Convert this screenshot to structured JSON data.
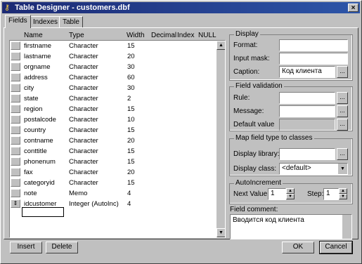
{
  "window": {
    "title": "Table Designer - customers.dbf",
    "close": "×"
  },
  "tabs": [
    "Fields",
    "Indexes",
    "Table"
  ],
  "columns": [
    "Name",
    "Type",
    "Width",
    "Decimal",
    "Index",
    "NULL"
  ],
  "fields": [
    {
      "name": "firstname",
      "type": "Character",
      "width": "15"
    },
    {
      "name": "lastname",
      "type": "Character",
      "width": "20"
    },
    {
      "name": "orgname",
      "type": "Character",
      "width": "30"
    },
    {
      "name": "address",
      "type": "Character",
      "width": "60"
    },
    {
      "name": "city",
      "type": "Character",
      "width": "30"
    },
    {
      "name": "state",
      "type": "Character",
      "width": "2"
    },
    {
      "name": "region",
      "type": "Character",
      "width": "15"
    },
    {
      "name": "postalcode",
      "type": "Character",
      "width": "10"
    },
    {
      "name": "country",
      "type": "Character",
      "width": "15"
    },
    {
      "name": "contname",
      "type": "Character",
      "width": "20"
    },
    {
      "name": "conttitle",
      "type": "Character",
      "width": "15"
    },
    {
      "name": "phonenum",
      "type": "Character",
      "width": "15"
    },
    {
      "name": "fax",
      "type": "Character",
      "width": "20"
    },
    {
      "name": "categoryid",
      "type": "Character",
      "width": "15"
    },
    {
      "name": "note",
      "type": "Memo",
      "width": "4"
    },
    {
      "name": "idcustomer",
      "type": "Integer (AutoInc)",
      "width": "4"
    }
  ],
  "display": {
    "legend": "Display",
    "format_label": "Format:",
    "format_value": "",
    "inputmask_label": "Input mask:",
    "inputmask_value": "",
    "caption_label": "Caption:",
    "caption_value": "Код клиента"
  },
  "validation": {
    "legend": "Field validation",
    "rule_label": "Rule:",
    "message_label": "Message:",
    "default_label": "Default value"
  },
  "mapping": {
    "legend": "Map field type to classes",
    "library_label": "Display library:",
    "library_value": "",
    "class_label": "Display class:",
    "class_value": "<default>"
  },
  "autoinc": {
    "legend": "AutoIncrement",
    "next_label": "Next Value:",
    "next_value": "1",
    "step_label": "Step:",
    "step_value": "1"
  },
  "comment": {
    "label": "Field comment:",
    "value": "Вводится код клиента"
  },
  "buttons": {
    "insert": "Insert",
    "delete": "Delete",
    "ok": "OK",
    "cancel": "Cancel"
  },
  "glyphs": {
    "ellipsis": "...",
    "key": "⚷"
  },
  "colors": {
    "titlebar": "#1c2a74",
    "face": "#c0c0c0"
  }
}
